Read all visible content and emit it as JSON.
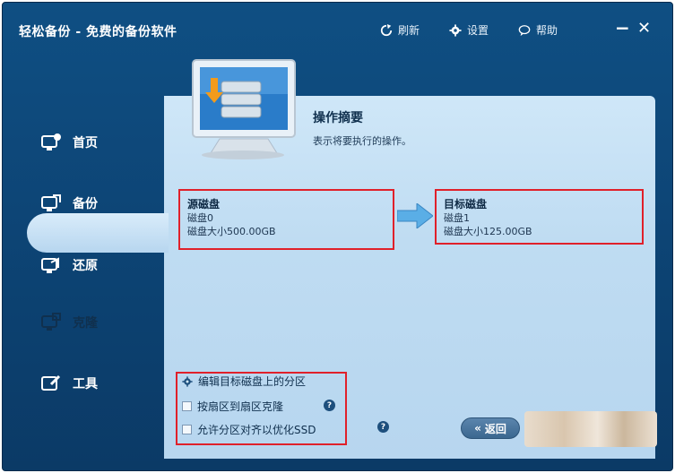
{
  "app": {
    "title": "轻松备份 - 免费的备份软件"
  },
  "toolbar": {
    "refresh_label": "刷新",
    "settings_label": "设置",
    "help_label": "帮助",
    "minimize_label": "−",
    "close_label": "✕"
  },
  "sidebar": {
    "items": [
      {
        "label": "首页",
        "icon": "home-icon"
      },
      {
        "label": "备份",
        "icon": "backup-icon"
      },
      {
        "label": "还原",
        "icon": "restore-icon"
      },
      {
        "label": "克隆",
        "icon": "clone-icon",
        "active": true
      },
      {
        "label": "工具",
        "icon": "tools-icon"
      }
    ]
  },
  "summary": {
    "title": "操作摘要",
    "description": "表示将要执行的操作。"
  },
  "source_disk": {
    "heading": "源磁盘",
    "name": "磁盘0",
    "size": "磁盘大小500.00GB"
  },
  "target_disk": {
    "heading": "目标磁盘",
    "name": "磁盘1",
    "size": "磁盘大小125.00GB"
  },
  "options": {
    "edit_partitions": "编辑目标磁盘上的分区",
    "sector_clone": "按扇区到扇区克隆",
    "align_ssd": "允许分区对齐以优化SSD"
  },
  "buttons": {
    "back_label": "返回"
  },
  "colors": {
    "window_bg": "#0d4576",
    "panel_bg": "#c4dff3",
    "highlight_red": "#e0202a"
  }
}
